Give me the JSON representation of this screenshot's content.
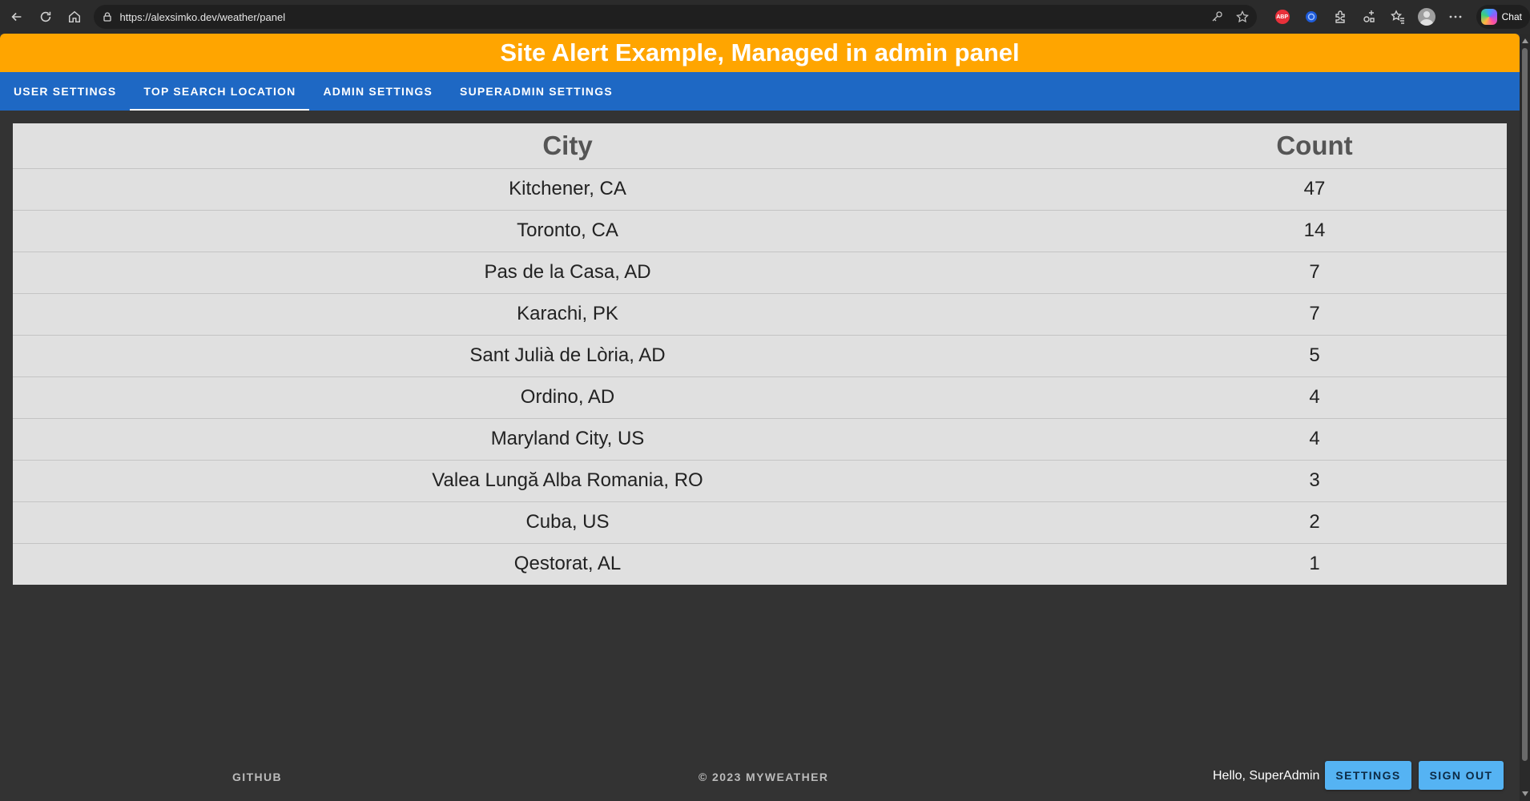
{
  "browser": {
    "url": "https://alexsimko.dev/weather/panel",
    "chat_label": "Chat",
    "abp_label": "ABP"
  },
  "alert": {
    "text": "Site Alert Example, Managed in admin panel",
    "color": "#ffa500"
  },
  "tabs": [
    {
      "label": "USER SETTINGS",
      "active": false
    },
    {
      "label": "TOP SEARCH LOCATION",
      "active": true
    },
    {
      "label": "ADMIN SETTINGS",
      "active": false
    },
    {
      "label": "SUPERADMIN SETTINGS",
      "active": false
    }
  ],
  "table": {
    "headers": {
      "city": "City",
      "count": "Count"
    },
    "rows": [
      {
        "city": "Kitchener, CA",
        "count": "47"
      },
      {
        "city": "Toronto, CA",
        "count": "14"
      },
      {
        "city": "Pas de la Casa, AD",
        "count": "7"
      },
      {
        "city": "Karachi, PK",
        "count": "7"
      },
      {
        "city": "Sant Julià de Lòria, AD",
        "count": "5"
      },
      {
        "city": "Ordino, AD",
        "count": "4"
      },
      {
        "city": "Maryland City, US",
        "count": "4"
      },
      {
        "city": "Valea Lungă Alba Romania, RO",
        "count": "3"
      },
      {
        "city": "Cuba, US",
        "count": "2"
      },
      {
        "city": "Qestorat, AL",
        "count": "1"
      }
    ]
  },
  "footer": {
    "github_label": "GITHUB",
    "copyright": "© 2023 MYWEATHER",
    "greeting": "Hello, SuperAdmin",
    "settings_label": "SETTINGS",
    "signout_label": "SIGN OUT"
  },
  "colors": {
    "tab_bar": "#1e68c4",
    "button": "#55b3f3",
    "background": "#333333",
    "table": "#e0e0e0"
  }
}
